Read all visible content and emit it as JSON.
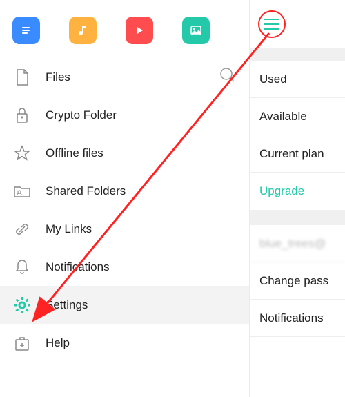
{
  "top_icons": [
    "document",
    "music",
    "video",
    "image"
  ],
  "menu": {
    "items": [
      {
        "label": "Files",
        "icon": "file"
      },
      {
        "label": "Crypto Folder",
        "icon": "lock"
      },
      {
        "label": "Offline files",
        "icon": "star"
      },
      {
        "label": "Shared Folders",
        "icon": "shared-folder"
      },
      {
        "label": "My Links",
        "icon": "link"
      },
      {
        "label": "Notifications",
        "icon": "bell"
      },
      {
        "label": "Settings",
        "icon": "gear",
        "active": true
      },
      {
        "label": "Help",
        "icon": "help"
      }
    ]
  },
  "right_panel": {
    "items": [
      {
        "label": "Used"
      },
      {
        "label": "Available"
      },
      {
        "label": "Current plan"
      },
      {
        "label": "Upgrade",
        "style": "upgrade"
      }
    ],
    "account_email_blurred": "blue_trees@",
    "lower_items": [
      {
        "label": "Change pass"
      },
      {
        "label": "Notifications"
      }
    ]
  },
  "colors": {
    "accent_teal": "#23c9a9",
    "arrow_red": "#ff2222"
  }
}
